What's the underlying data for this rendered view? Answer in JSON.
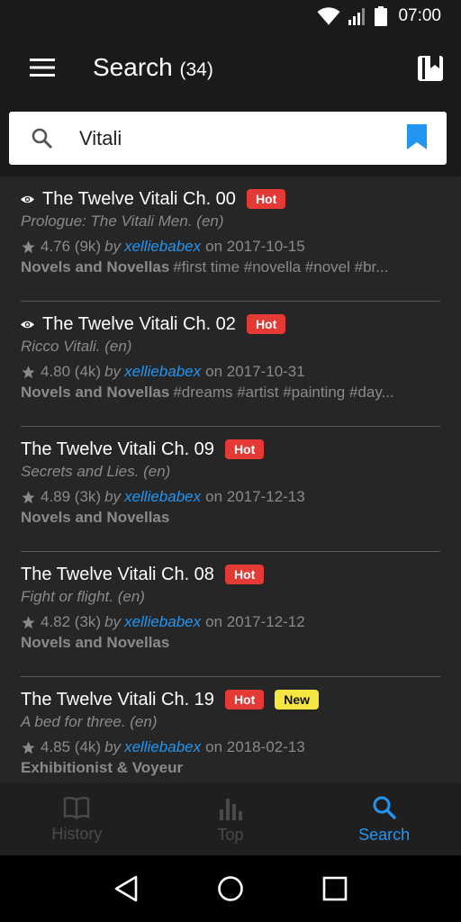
{
  "status_bar": {
    "time": "07:00"
  },
  "app_bar": {
    "title": "Search",
    "count": "(34)"
  },
  "search": {
    "value": "Vitali"
  },
  "results": [
    {
      "viewed": true,
      "title": "The Twelve Vitali Ch. 00",
      "badges": [
        "Hot"
      ],
      "description": "Prologue: The Vitali Men. (en)",
      "rating": "4.76 (9k)",
      "by": "by",
      "author": "xelliebabex",
      "date": "on 2017-10-15",
      "category": "Novels and Novellas",
      "tags": "#first time #novella #novel #br..."
    },
    {
      "viewed": true,
      "title": "The Twelve Vitali Ch. 02",
      "badges": [
        "Hot"
      ],
      "description": "Ricco Vitali. (en)",
      "rating": "4.80 (4k)",
      "by": "by",
      "author": "xelliebabex",
      "date": "on 2017-10-31",
      "category": "Novels and Novellas",
      "tags": "#dreams #artist #painting #day..."
    },
    {
      "viewed": false,
      "title": "The Twelve Vitali Ch. 09",
      "badges": [
        "Hot"
      ],
      "description": "Secrets and Lies. (en)",
      "rating": "4.89 (3k)",
      "by": "by",
      "author": "xelliebabex",
      "date": "on 2017-12-13",
      "category": "Novels and Novellas",
      "tags": ""
    },
    {
      "viewed": false,
      "title": "The Twelve Vitali Ch. 08",
      "badges": [
        "Hot"
      ],
      "description": "Fight or flight. (en)",
      "rating": "4.82 (3k)",
      "by": "by",
      "author": "xelliebabex",
      "date": "on 2017-12-12",
      "category": "Novels and Novellas",
      "tags": ""
    },
    {
      "viewed": false,
      "title": "The Twelve Vitali Ch. 19",
      "badges": [
        "Hot",
        "New"
      ],
      "description": "A bed for three. (en)",
      "rating": "4.85 (4k)",
      "by": "by",
      "author": "xelliebabex",
      "date": "on 2018-02-13",
      "category": "Exhibitionist & Voyeur",
      "tags": ""
    }
  ],
  "bottom_nav": [
    {
      "label": "History",
      "icon": "book-open-icon",
      "active": false
    },
    {
      "label": "Top",
      "icon": "bar-chart-icon",
      "active": false
    },
    {
      "label": "Search",
      "icon": "search-icon",
      "active": true
    }
  ],
  "colors": {
    "accent": "#2196f3",
    "hot": "#e53935",
    "new": "#f5e642"
  }
}
